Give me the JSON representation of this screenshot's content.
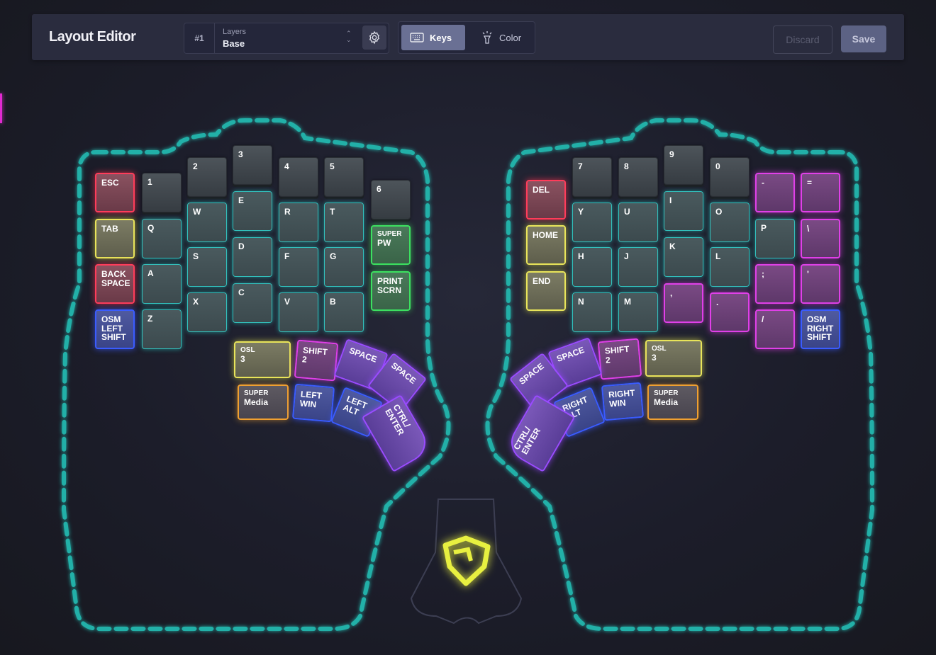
{
  "app": {
    "title": "Layout Editor"
  },
  "layer": {
    "number": "#1",
    "caption": "Layers",
    "value": "Base"
  },
  "modes": {
    "keys": "Keys",
    "color": "Color",
    "active": "Keys"
  },
  "actions": {
    "discard": "Discard",
    "save": "Save"
  },
  "icons": [
    "gear-icon",
    "keyboard-icon",
    "flashlight-icon",
    "chevron-updown-icon",
    "zsa-logo-icon"
  ],
  "colors": {
    "teal": "#32c0bc",
    "red": "#ff3c5a",
    "yellow": "#e8e45a",
    "blue": "#3a5cff",
    "green": "#3ce060",
    "magenta": "#e040e8",
    "purple": "#9a4cff",
    "orange": "#f0a030",
    "outline": "#20b0a8"
  },
  "left_keys": {
    "esc": "ESC",
    "tab": "TAB",
    "backspace": [
      "BACK",
      "SPACE"
    ],
    "osm_left_shift": [
      "OSM",
      "LEFT",
      "SHIFT"
    ],
    "n1": "1",
    "n2": "2",
    "n3": "3",
    "n4": "4",
    "n5": "5",
    "n6": "6",
    "q": "Q",
    "w": "W",
    "e": "E",
    "r": "R",
    "t": "T",
    "a": "A",
    "s": "S",
    "d": "D",
    "f": "F",
    "g": "G",
    "z": "Z",
    "x": "X",
    "c": "C",
    "v": "V",
    "b": "B",
    "super_pw": [
      "SUPER",
      "PW"
    ],
    "print_scrn": [
      "PRINT",
      "SCRN"
    ]
  },
  "left_thumb": {
    "osl3": [
      "OSL",
      "3"
    ],
    "shift2": [
      "SHIFT",
      "2"
    ],
    "space1": "SPACE",
    "space2": "SPACE",
    "super_media": [
      "SUPER",
      "Media"
    ],
    "left_win": [
      "LEFT",
      "WIN"
    ],
    "left_alt": [
      "LEFT",
      "ALT"
    ],
    "ctrl_enter": [
      "CTRL/",
      "ENTER"
    ]
  },
  "right_keys": {
    "n7": "7",
    "n8": "8",
    "n9": "9",
    "n0": "0",
    "minus": "-",
    "equals": "=",
    "del": "DEL",
    "home": "HOME",
    "end": "END",
    "y": "Y",
    "u": "U",
    "i": "I",
    "o": "O",
    "p": "P",
    "backslash": "\\",
    "h": "H",
    "j": "J",
    "k": "K",
    "l": "L",
    "semicolon": ";",
    "quote": "'",
    "n": "N",
    "m": "M",
    "comma": ",",
    "period": ".",
    "slash": "/",
    "osm_right_shift": [
      "OSM",
      "RIGHT",
      "SHIFT"
    ]
  },
  "right_thumb": {
    "space1": "SPACE",
    "space2": "SPACE",
    "shift2": [
      "SHIFT",
      "2"
    ],
    "osl3": [
      "OSL",
      "3"
    ],
    "ctrl_enter": [
      "CTRL/",
      "ENTER"
    ],
    "right_alt": [
      "RIGHT",
      "ALT"
    ],
    "right_win": [
      "RIGHT",
      "WIN"
    ],
    "super_media": [
      "SUPER",
      "Media"
    ]
  }
}
